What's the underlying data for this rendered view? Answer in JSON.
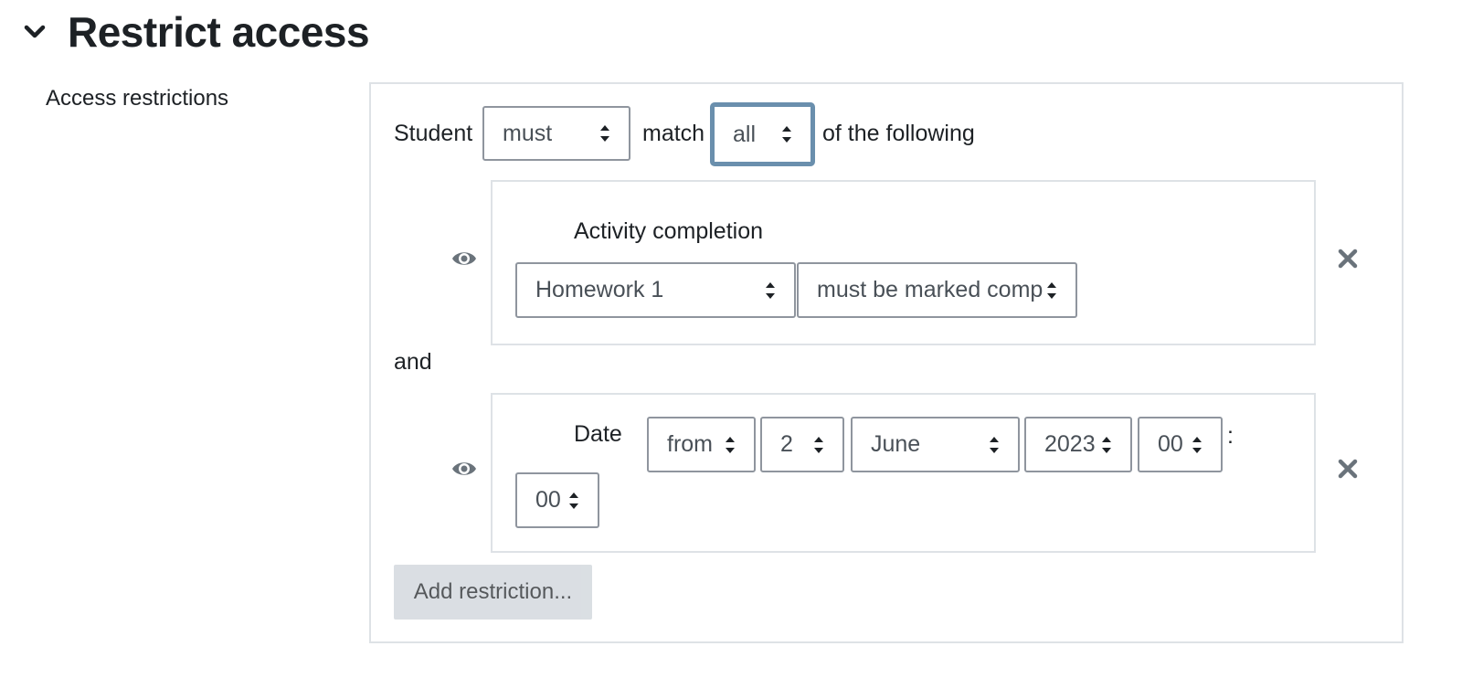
{
  "section": {
    "title": "Restrict access",
    "chevron_icon": "chevron-down-icon"
  },
  "field_label": "Access restrictions",
  "header": {
    "student_label": "Student",
    "must_select": "must",
    "match_label": "match",
    "all_select": "all",
    "following_label": "of the following"
  },
  "conditions": [
    {
      "title": "Activity completion",
      "activity_select": "Homework 1",
      "state_select": "must be marked comp"
    },
    {
      "title": "Date",
      "direction_select": "from",
      "day_select": "2",
      "month_select": "June",
      "year_select": "2023",
      "hour_select": "00",
      "colon": ":",
      "minute_select": "00"
    }
  ],
  "connector": "and",
  "add_button": "Add restriction...",
  "colors": {
    "focus_border": "#6a8fad",
    "input_border": "#8f959e",
    "box_border": "#dee2e6",
    "button_bg": "#ced4da"
  }
}
